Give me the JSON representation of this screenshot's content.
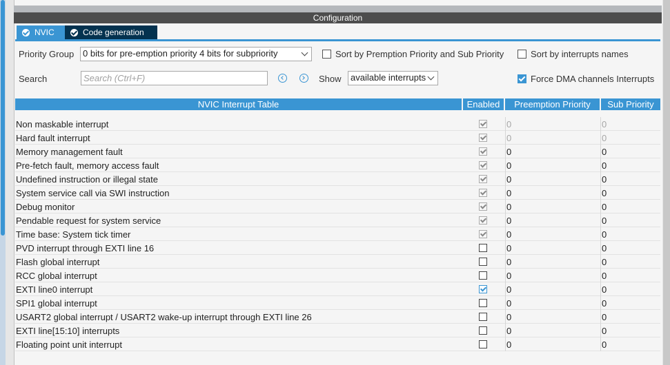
{
  "header": {
    "title": "Configuration"
  },
  "tabs": [
    {
      "label": "NVIC",
      "active": true
    },
    {
      "label": "Code generation",
      "active": false
    }
  ],
  "controls": {
    "priority_group_label": "Priority Group",
    "priority_group_value": "0 bits for pre-emption priority 4 bits for subpriority",
    "sort_premption_label": "Sort by Premption Priority and Sub Priority",
    "sort_premption_checked": false,
    "sort_names_label": "Sort by interrupts names",
    "sort_names_checked": false,
    "search_label": "Search",
    "search_placeholder": "Search (Ctrl+F)",
    "show_label": "Show",
    "show_value": "available interrupts",
    "force_dma_label": "Force DMA channels Interrupts",
    "force_dma_checked": true
  },
  "table": {
    "headers": [
      "NVIC Interrupt Table",
      "Enabled",
      "Preemption Priority",
      "Sub Priority"
    ],
    "rows": [
      {
        "name": "Non maskable interrupt",
        "enabled": true,
        "locked": true,
        "preemption": "0",
        "sub": "0",
        "priority_disabled": true
      },
      {
        "name": "Hard fault interrupt",
        "enabled": true,
        "locked": true,
        "preemption": "0",
        "sub": "0",
        "priority_disabled": true
      },
      {
        "name": "Memory management fault",
        "enabled": true,
        "locked": true,
        "preemption": "0",
        "sub": "0",
        "priority_disabled": false
      },
      {
        "name": "Pre-fetch fault, memory access fault",
        "enabled": true,
        "locked": true,
        "preemption": "0",
        "sub": "0",
        "priority_disabled": false
      },
      {
        "name": "Undefined instruction or illegal state",
        "enabled": true,
        "locked": true,
        "preemption": "0",
        "sub": "0",
        "priority_disabled": false
      },
      {
        "name": "System service call via SWI instruction",
        "enabled": true,
        "locked": true,
        "preemption": "0",
        "sub": "0",
        "priority_disabled": false
      },
      {
        "name": "Debug monitor",
        "enabled": true,
        "locked": true,
        "preemption": "0",
        "sub": "0",
        "priority_disabled": false
      },
      {
        "name": "Pendable request for system service",
        "enabled": true,
        "locked": true,
        "preemption": "0",
        "sub": "0",
        "priority_disabled": false
      },
      {
        "name": "Time base: System tick timer",
        "enabled": true,
        "locked": true,
        "preemption": "0",
        "sub": "0",
        "priority_disabled": false
      },
      {
        "name": "PVD interrupt through EXTI line 16",
        "enabled": false,
        "locked": false,
        "preemption": "0",
        "sub": "0",
        "priority_disabled": false
      },
      {
        "name": "Flash global interrupt",
        "enabled": false,
        "locked": false,
        "preemption": "0",
        "sub": "0",
        "priority_disabled": false
      },
      {
        "name": "RCC global interrupt",
        "enabled": false,
        "locked": false,
        "preemption": "0",
        "sub": "0",
        "priority_disabled": false
      },
      {
        "name": "EXTI line0 interrupt",
        "enabled": true,
        "locked": false,
        "preemption": "0",
        "sub": "0",
        "priority_disabled": false
      },
      {
        "name": "SPI1 global interrupt",
        "enabled": false,
        "locked": false,
        "preemption": "0",
        "sub": "0",
        "priority_disabled": false
      },
      {
        "name": "USART2 global interrupt / USART2 wake-up interrupt through EXTI line 26",
        "enabled": false,
        "locked": false,
        "preemption": "0",
        "sub": "0",
        "priority_disabled": false
      },
      {
        "name": "EXTI line[15:10] interrupts",
        "enabled": false,
        "locked": false,
        "preemption": "0",
        "sub": "0",
        "priority_disabled": false
      },
      {
        "name": "Floating point unit interrupt",
        "enabled": false,
        "locked": false,
        "preemption": "0",
        "sub": "0",
        "priority_disabled": false
      }
    ]
  }
}
